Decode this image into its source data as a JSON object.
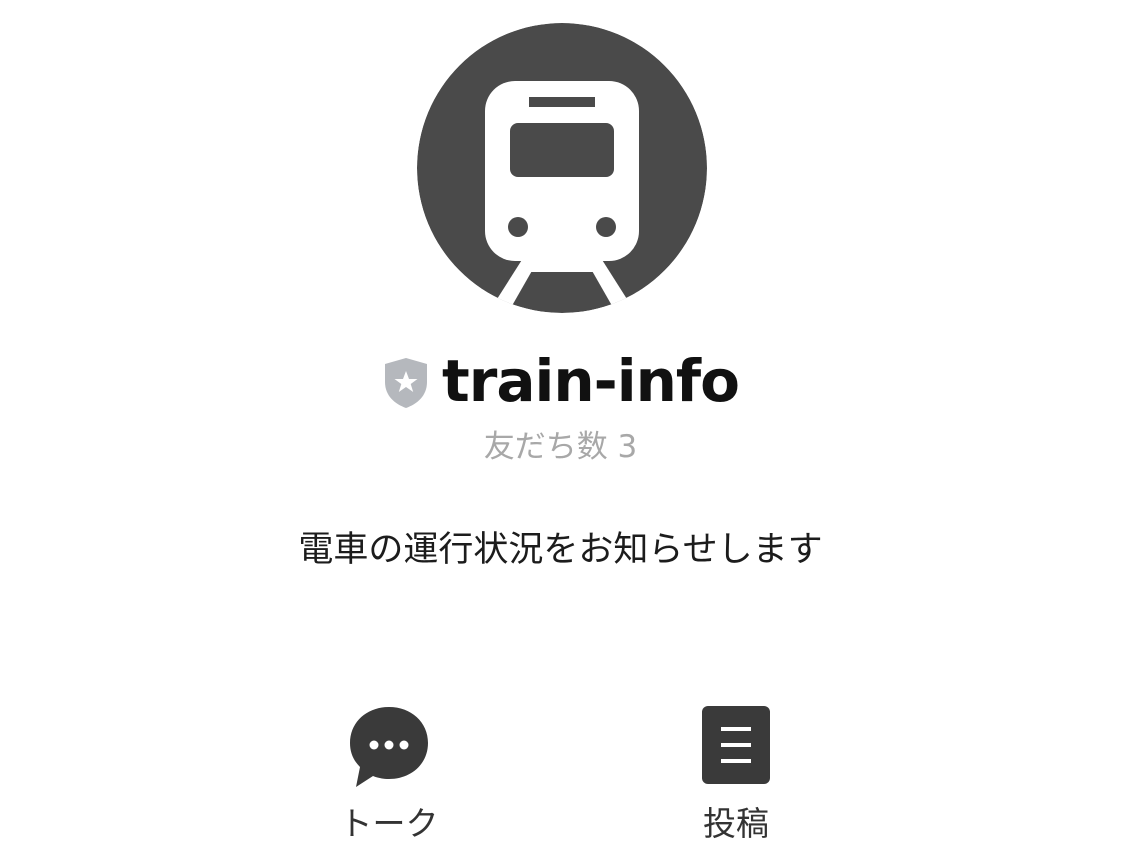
{
  "profile": {
    "avatar_icon": "train-icon",
    "badge_icon": "verified-star-shield-icon",
    "name": "train-info",
    "friends_count_text": "友だち数 3",
    "status_message": "電車の運行状況をお知らせします"
  },
  "actions": [
    {
      "label": "トーク",
      "icon": "chat-bubble-icon"
    },
    {
      "label": "投稿",
      "icon": "post-document-icon"
    }
  ],
  "colors": {
    "avatar_background": "#4a4a4a",
    "badge": "#b5b8bd",
    "icon_dark": "#3a3a3a",
    "muted_text": "#a8a8a8"
  }
}
